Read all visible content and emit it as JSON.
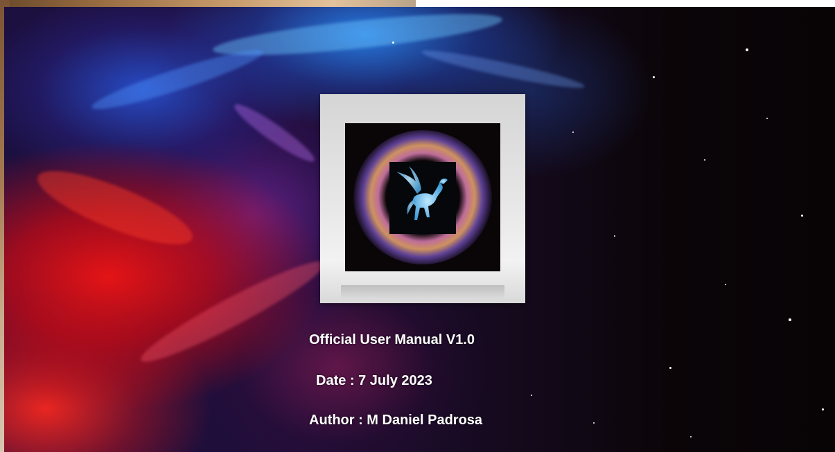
{
  "cover": {
    "title": "Official User Manual V1.0",
    "date": "Date : 7 July 2023",
    "author": "Author : M Daniel Padrosa"
  },
  "emblem": {
    "icon": "pegasus-icon",
    "background_icon": "nebula-icon"
  },
  "colors": {
    "text": "#ffffff",
    "frame": "#e2e2e2",
    "nebula_red": "#e81414",
    "nebula_blue": "#2a8cff",
    "space_dark": "#080406"
  }
}
